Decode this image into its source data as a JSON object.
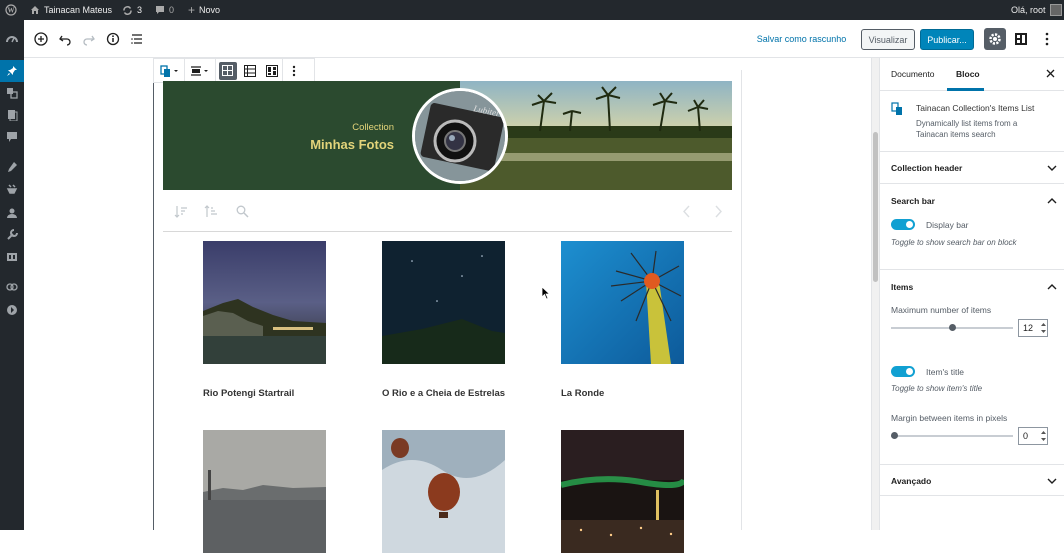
{
  "adminbar": {
    "site_name": "Tainacan Mateus",
    "updates_count": "3",
    "comments_count": "0",
    "new_label": "Novo",
    "greeting": "Olá, root"
  },
  "toolbar": {
    "save_draft": "Salvar como rascunho",
    "preview": "Visualizar",
    "publish": "Publicar..."
  },
  "header": {
    "collection_label": "Collection",
    "collection_name": "Minhas Fotos"
  },
  "items": [
    {
      "title": "Rio Potengi Startrail"
    },
    {
      "title": "O Rio e a Cheia de Estrelas"
    },
    {
      "title": "La Ronde"
    },
    {
      "title": ""
    },
    {
      "title": ""
    },
    {
      "title": ""
    }
  ],
  "sidebar": {
    "tabs": [
      "Documento",
      "Bloco"
    ],
    "active_tab": "Bloco",
    "block_name": "Tainacan Collection's Items List",
    "block_desc_line1": "Dynamically list items from a",
    "block_desc_line2": "Tainacan items search",
    "collection_header": "Collection header",
    "search_bar": "Search bar",
    "display_bar": "Display bar",
    "display_bar_hint": "Toggle to show search bar on block",
    "items_title": "Items",
    "max_items_label": "Maximum number of items",
    "max_items_value": "12",
    "max_items_fraction": 0.5,
    "item_title_label": "Item's title",
    "item_title_hint": "Toggle to show item's title",
    "margin_label": "Margin between items in pixels",
    "margin_value": "0",
    "margin_fraction": 0,
    "advanced": "Avançado"
  },
  "colors": {
    "admin_bg": "#23282d",
    "accent": "#0073aa",
    "toggle": "#11a0d2",
    "header_green": "#2b4a2f",
    "collection_name": "#e3d47a"
  }
}
